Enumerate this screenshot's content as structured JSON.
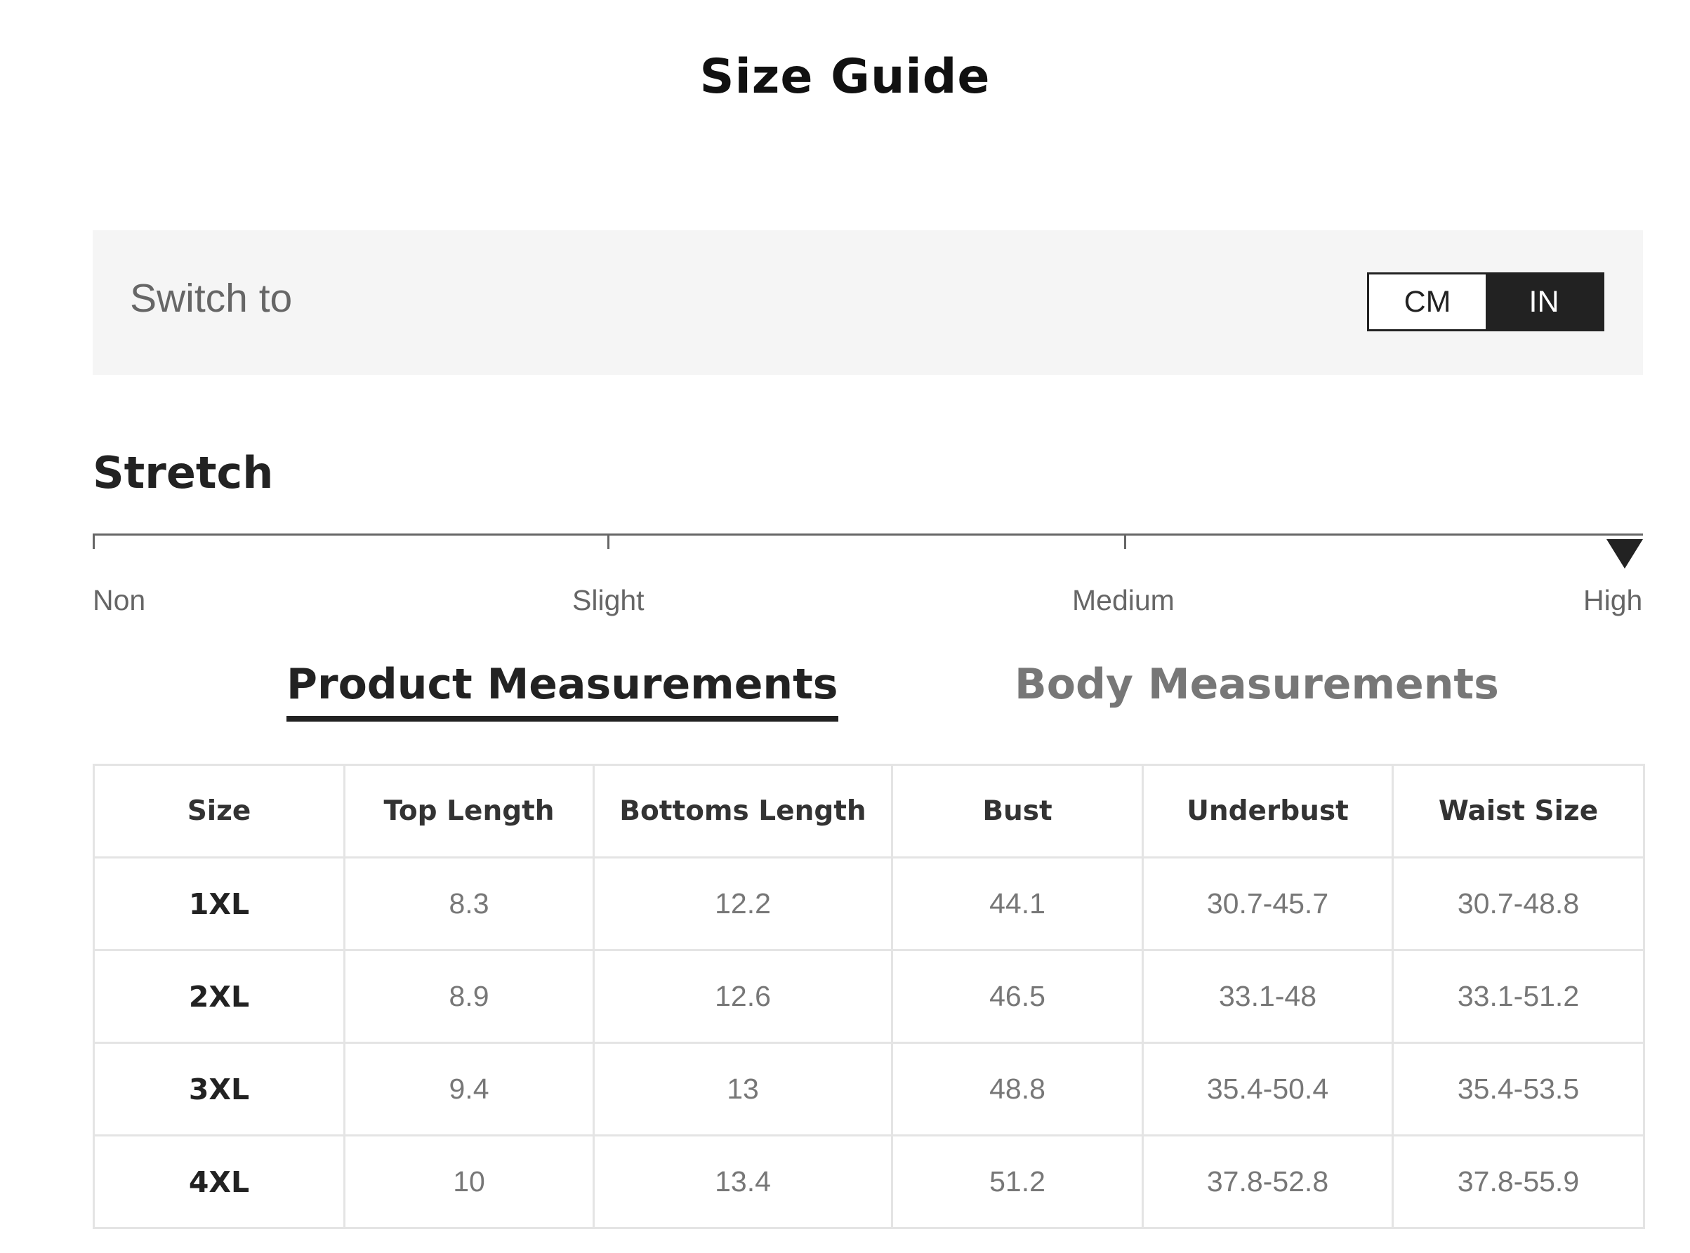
{
  "title": "Size Guide",
  "unit_switch": {
    "label": "Switch to",
    "options": [
      "CM",
      "IN"
    ],
    "selected": "IN"
  },
  "stretch": {
    "title": "Stretch",
    "levels": [
      "Non",
      "Slight",
      "Medium",
      "High"
    ],
    "selected": "High"
  },
  "tabs": [
    {
      "label": "Product Measurements",
      "active": true
    },
    {
      "label": "Body Measurements",
      "active": false
    }
  ],
  "table": {
    "headers": [
      "Size",
      "Top Length",
      "Bottoms Length",
      "Bust",
      "Underbust",
      "Waist Size"
    ],
    "rows": [
      [
        "1XL",
        "8.3",
        "12.2",
        "44.1",
        "30.7-45.7",
        "30.7-48.8"
      ],
      [
        "2XL",
        "8.9",
        "12.6",
        "46.5",
        "33.1-48",
        "33.1-51.2"
      ],
      [
        "3XL",
        "9.4",
        "13",
        "48.8",
        "35.4-50.4",
        "35.4-53.5"
      ],
      [
        "4XL",
        "10",
        "13.4",
        "51.2",
        "37.8-52.8",
        "37.8-55.9"
      ]
    ]
  },
  "colors": {
    "accent": "#222222",
    "panel_bg": "#f5f5f5",
    "muted_text": "#777777",
    "border": "#e4e4e4"
  }
}
